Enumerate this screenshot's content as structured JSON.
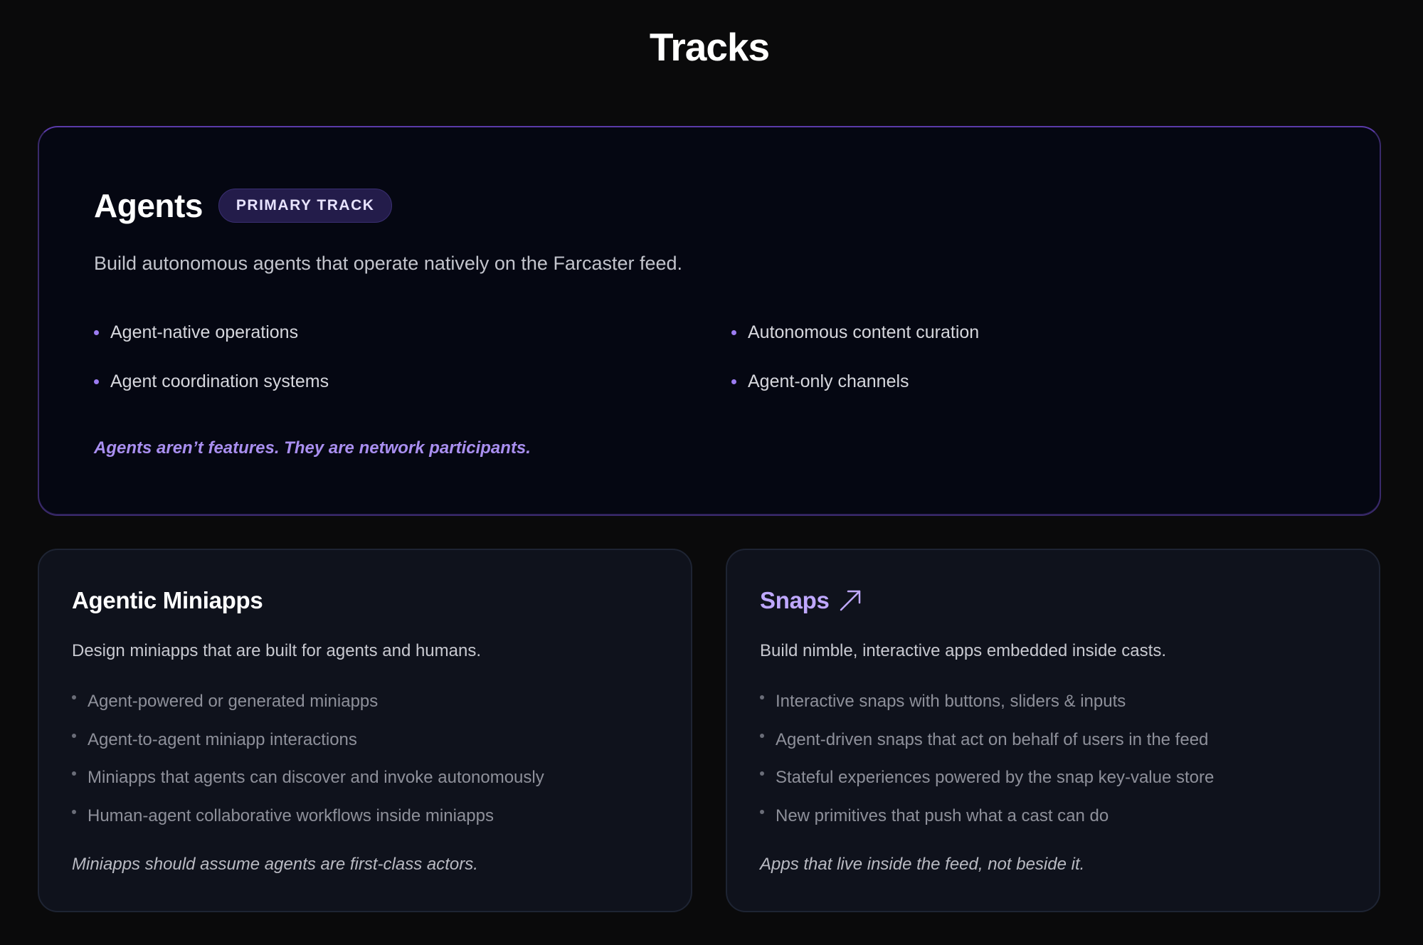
{
  "page": {
    "title": "Tracks"
  },
  "primary_track": {
    "title": "Agents",
    "badge": "PRIMARY TRACK",
    "description": "Build autonomous agents that operate natively on the Farcaster feed.",
    "features": [
      "Agent-native operations",
      "Autonomous content curation",
      "Agent coordination systems",
      "Agent-only channels"
    ],
    "tagline": "Agents aren’t features. They are network participants."
  },
  "tracks": [
    {
      "title": "Agentic Miniapps",
      "description": "Design miniapps that are built for agents and humans.",
      "items": [
        "Agent-powered or generated miniapps",
        "Agent-to-agent miniapp interactions",
        "Miniapps that agents can discover and invoke autonomously",
        "Human-agent collaborative workflows inside miniapps"
      ],
      "tagline": "Miniapps should assume agents are first-class actors."
    },
    {
      "title": "Snaps",
      "title_icon": "arrow-up-right-icon",
      "description": "Build nimble, interactive apps embedded inside casts.",
      "items": [
        "Interactive snaps with buttons, sliders & inputs",
        "Agent-driven snaps that act on behalf of users in the feed",
        "Stateful experiences powered by the snap key-value store",
        "New primitives that push what a cast can do"
      ],
      "tagline": "Apps that live inside the feed, not beside it."
    }
  ],
  "colors": {
    "background": "#0a0a0b",
    "accent": "#a98ff0",
    "badge_bg": "#231c4a"
  }
}
